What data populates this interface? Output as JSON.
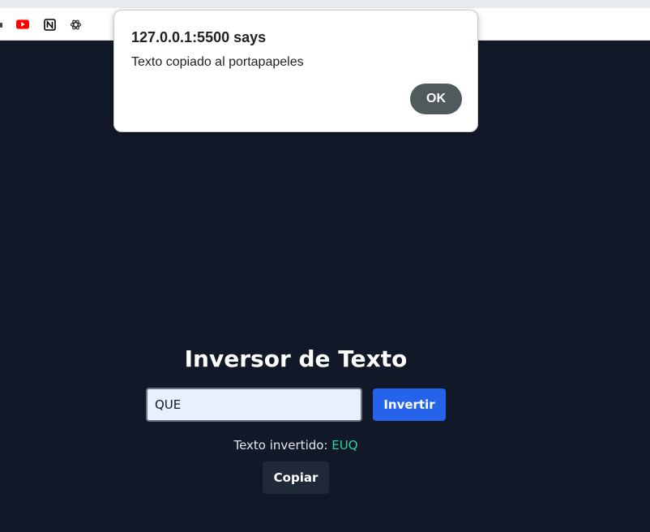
{
  "bookmarks": {
    "icons": [
      "youtube-icon",
      "notion-icon",
      "openai-icon"
    ]
  },
  "alert": {
    "title": "127.0.0.1:5500 says",
    "message": "Texto copiado al portapapeles",
    "ok_label": "OK"
  },
  "app": {
    "title": "Inversor de Texto",
    "input_value": "QUE",
    "invert_label": "Invertir",
    "result_label": "Texto invertido:",
    "result_value": "EUQ",
    "copy_label": "Copiar"
  },
  "colors": {
    "background": "#111827",
    "accent_blue": "#2563eb",
    "result_green": "#34d399",
    "ok_button": "#50595b"
  }
}
